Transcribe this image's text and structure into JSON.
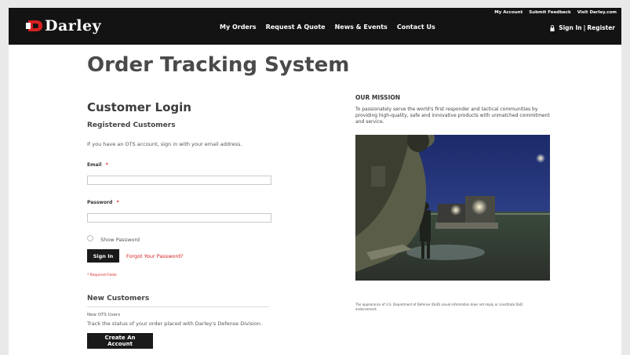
{
  "header": {
    "logo_text": "Darley",
    "utility_links": [
      "My Account",
      "Submit Feedback",
      "Visit Darley.com"
    ],
    "nav": [
      "My Orders",
      "Request A Quote",
      "News & Events",
      "Contact Us"
    ],
    "sign_in": "Sign In",
    "separator": "|",
    "register": "Register"
  },
  "page": {
    "title": "Order Tracking System"
  },
  "login": {
    "heading": "Customer Login",
    "registered_heading": "Registered Customers",
    "intro": "If you have an OTS account, sign in with your email address.",
    "email_label": "Email",
    "password_label": "Password",
    "required_mark": "*",
    "email_value": "",
    "password_value": "",
    "show_password_label": "Show Password",
    "sign_in_button": "Sign In",
    "forgot_link": "Forgot Your Password?",
    "required_fields": "* Required Fields"
  },
  "new_customers": {
    "heading": "New Customers",
    "subheading": "New OTS Users",
    "text": "Track the status of your order placed with Darley's Defense Division.",
    "button": "Create An Account"
  },
  "mission": {
    "title": "OUR MISSION",
    "text": "To passionately serve the world's first responder and tactical communities by providing high-quality, safe and innovative products with unmatched commitment and service.",
    "disclaimer": "The appearance of U.S. Department of Defense (DoD) visual information does not imply or constitute DoD endorsement."
  },
  "colors": {
    "header_bg": "#131313",
    "accent_red": "#d62020",
    "button_bg": "#1a1a1a"
  }
}
